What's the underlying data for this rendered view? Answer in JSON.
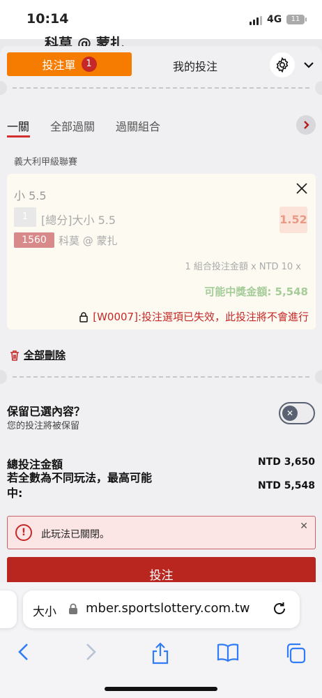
{
  "status_bar": {
    "time": "10:14",
    "network": "4G",
    "battery": "11"
  },
  "background_header": {
    "match_peek": "科莫 @ 蒙扎"
  },
  "tabs": {
    "bet_slip_label": "投注單",
    "bet_slip_count": "1",
    "my_bets_label": "我的投注"
  },
  "modes": {
    "single": "一關",
    "all_parlay": "全部過關",
    "parlay_combo": "過關組合"
  },
  "league": "義大利甲級聯賽",
  "bet": {
    "selection": "小 5.5",
    "leg_index": "1",
    "market": "[總分]大小 5.5",
    "odds": "1.52",
    "match_code": "1560",
    "match": "科莫 @ 蒙扎",
    "combo_text": "1 組合投注金額 x NTD 10 x",
    "payout_text": "可能中獎金額: 5,548",
    "warning": "[W0007]:投注選項已失效，此投注將不會進行"
  },
  "delete_all": "全部刪除",
  "keep": {
    "title": "保留已選內容？",
    "subtitle": "您的投注將被保留",
    "enabled": false
  },
  "totals": {
    "total_label": "總投注金額",
    "total_value": "NTD 3,650",
    "max_label": "若全數為不同玩法，最高可能中:",
    "max_value": "NTD 5,548"
  },
  "alert": {
    "message": "此玩法已關閉。"
  },
  "submit_label": "投注",
  "browser": {
    "text_size": "大小",
    "url": "mber.sportslottery.com.tw"
  },
  "colors": {
    "accent": "#f57c00",
    "danger": "#c62828",
    "submit": "#b8261f",
    "payout": "#a5cc99"
  }
}
